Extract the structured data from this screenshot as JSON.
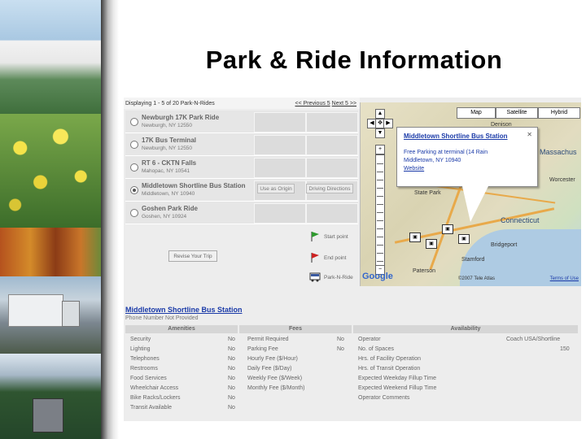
{
  "slide_title": "Park & Ride Information",
  "results": {
    "count_text": "Displaying 1 - 5 of 20 Park-N-Rides",
    "prev_label": "<< Previous 5",
    "next_label": "Next 5 >>",
    "rows": [
      {
        "name": "Newburgh 17K Park Ride",
        "address": "Newburgh, NY 12550",
        "selected": false
      },
      {
        "name": "17K Bus Terminal",
        "address": "Newburgh, NY 12550",
        "selected": false
      },
      {
        "name": "RT 6 - CKTN Falls",
        "address": "Mahopac, NY 10541",
        "selected": false
      },
      {
        "name": "Middletown Shortline Bus Station",
        "address": "Middletown, NY 10940",
        "selected": true,
        "origin_label": "Use as Origin",
        "directions_label": "Driving Directions"
      },
      {
        "name": "Goshen Park Ride",
        "address": "Goshen, NY 10924",
        "selected": false
      }
    ],
    "revise_label": "Revise Your Trip"
  },
  "legend": {
    "start_label": "Start point",
    "end_label": "End point",
    "pnr_label": "Park-N-Ride"
  },
  "map": {
    "types": [
      "Map",
      "Satellite",
      "Hybrid"
    ],
    "labels": [
      "Massachus",
      "Connecticut",
      "Bridgeport",
      "Stamford",
      "Paterson",
      "Denison",
      "Worcester",
      "State Park"
    ],
    "popup": {
      "title": "Middletown Shortline Bus Station",
      "close": "✕",
      "parking": "Free Parking at terminal (14 Rain",
      "address": "Middletown, NY 10940",
      "website": "Website"
    },
    "logo": "Google",
    "copyright": "©2007 Tele Atlas",
    "terms": "Terms of Use"
  },
  "details": {
    "title": "Middletown Shortline Bus Station",
    "phone": "Phone Number Not Provided",
    "amenities_header": "Amenities",
    "fees_header": "Fees",
    "availability_header": "Availability",
    "amenities": [
      {
        "label": "Security",
        "value": "No"
      },
      {
        "label": "Lighting",
        "value": "No"
      },
      {
        "label": "Telephones",
        "value": "No"
      },
      {
        "label": "Restrooms",
        "value": "No"
      },
      {
        "label": "Food Services",
        "value": "No"
      },
      {
        "label": "Wheelchair Access",
        "value": "No"
      },
      {
        "label": "Bike Racks/Lockers",
        "value": "No"
      },
      {
        "label": "Transit Available",
        "value": "No"
      }
    ],
    "fees": [
      {
        "label": "Permit Required",
        "value": "No"
      },
      {
        "label": "Parking Fee",
        "value": "No"
      },
      {
        "label": "Hourly Fee ($/Hour)",
        "value": ""
      },
      {
        "label": "Daily Fee ($/Day)",
        "value": ""
      },
      {
        "label": "Weekly Fee ($/Week)",
        "value": ""
      },
      {
        "label": "Monthly Fee ($/Month)",
        "value": ""
      }
    ],
    "availability": [
      {
        "label": "Operator",
        "value": "Coach USA/Shortline"
      },
      {
        "label": "No. of Spaces",
        "value": "150"
      },
      {
        "label": "Hrs. of Facility Operation",
        "value": ""
      },
      {
        "label": "Hrs. of Transit Operation",
        "value": ""
      },
      {
        "label": "Expected Weekday Fillup Time",
        "value": ""
      },
      {
        "label": "Expected Weekend Fillup Time",
        "value": ""
      },
      {
        "label": "Operator Comments",
        "value": ""
      }
    ]
  }
}
